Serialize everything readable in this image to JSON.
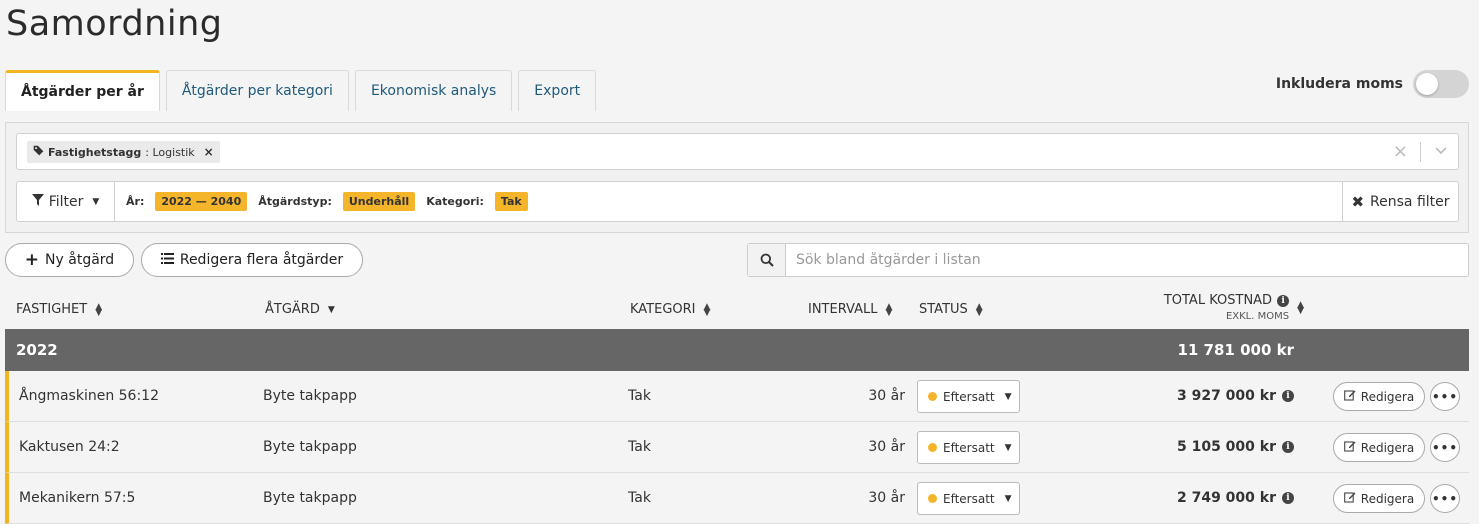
{
  "page": {
    "title": "Samordning"
  },
  "tabs": [
    {
      "label": "Åtgärder per år",
      "active": true
    },
    {
      "label": "Åtgärder per kategori",
      "active": false
    },
    {
      "label": "Ekonomisk analys",
      "active": false
    },
    {
      "label": "Export",
      "active": false
    }
  ],
  "moms": {
    "label": "Inkludera moms",
    "on": false
  },
  "tag_select": {
    "chip_key": "Fastighetstagg",
    "chip_value": ": Logistik"
  },
  "filter": {
    "button_label": "Filter",
    "items": [
      {
        "label": "År:",
        "value": "2022 — 2040"
      },
      {
        "label": "Åtgärdstyp:",
        "value": "Underhåll"
      },
      {
        "label": "Kategori:",
        "value": "Tak"
      }
    ],
    "clear_label": "Rensa filter"
  },
  "actions": {
    "new_label": "Ny åtgärd",
    "bulk_edit_label": "Redigera flera åtgärder"
  },
  "search": {
    "placeholder": "Sök bland åtgärder i listan",
    "value": ""
  },
  "columns": {
    "fastighet": "FASTIGHET",
    "atgard": "ÅTGÄRD",
    "kategori": "KATEGORI",
    "intervall": "INTERVALL",
    "status": "STATUS",
    "total": "TOTAL KOSTNAD",
    "total_sub": "EXKL. MOMS"
  },
  "group": {
    "year": "2022",
    "total": "11 781 000 kr"
  },
  "rows": [
    {
      "fastighet": "Ångmaskinen 56:12",
      "atgard": "Byte takpapp",
      "kategori": "Tak",
      "intervall": "30 år",
      "status": "Eftersatt",
      "cost": "3 927 000 kr",
      "edit": "Redigera"
    },
    {
      "fastighet": "Kaktusen 24:2",
      "atgard": "Byte takpapp",
      "kategori": "Tak",
      "intervall": "30 år",
      "status": "Eftersatt",
      "cost": "5 105 000 kr",
      "edit": "Redigera"
    },
    {
      "fastighet": "Mekanikern 57:5",
      "atgard": "Byte takpapp",
      "kategori": "Tak",
      "intervall": "30 år",
      "status": "Eftersatt",
      "cost": "2 749 000 kr",
      "edit": "Redigera"
    }
  ],
  "colors": {
    "accent": "#f2b41f",
    "group_bg": "#666666",
    "tag_bg": "#f5b52a"
  }
}
